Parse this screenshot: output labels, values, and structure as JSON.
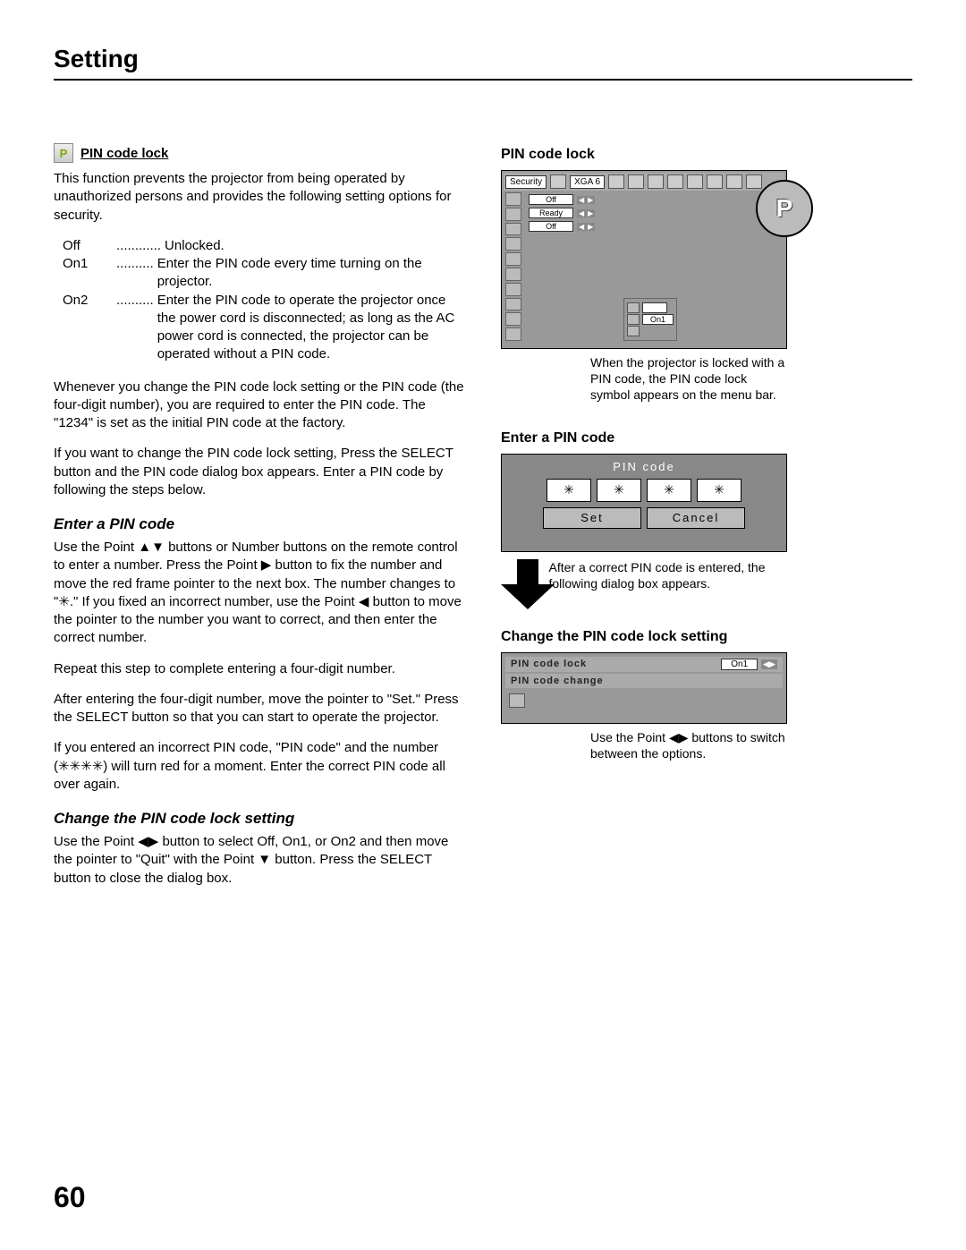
{
  "page": {
    "title": "Setting",
    "number": "60"
  },
  "left": {
    "heading1": "PIN code lock",
    "intro": "This function prevents the projector from being operated by unauthorized persons and provides the following setting options for security.",
    "options": [
      {
        "key": "Off",
        "dots": "............",
        "val": "Unlocked."
      },
      {
        "key": "On1",
        "dots": "..........",
        "val": "Enter the PIN code every time turning on the projector."
      },
      {
        "key": "On2",
        "dots": "..........",
        "val": "Enter the PIN code to operate the projector once the power cord is disconnected; as long as the AC power cord is connected, the projector can be operated without a PIN code."
      }
    ],
    "para2": "Whenever you change the PIN code lock setting or the PIN code (the four-digit number), you are required to enter the PIN code. The \"1234\" is set as the initial PIN code at the factory.",
    "para3": "If you want to change the PIN code lock setting, Press the SELECT button and the PIN code dialog box appears. Enter a PIN code by following the steps below.",
    "heading2": "Enter a PIN code",
    "enter_p1": "Use the Point ▲▼ buttons or Number buttons on the remote control to enter a number. Press the Point ▶ button to fix the number and move the red frame pointer to the next box. The number changes to \"✳.\" If you fixed an incorrect number, use the Point ◀ button to move the pointer to the number you want to correct, and then enter the correct number.",
    "enter_p2": "Repeat this step to complete entering a four-digit number.",
    "enter_p3": "After entering the four-digit number, move the pointer to \"Set.\" Press the SELECT button so that you can start to operate the projector.",
    "enter_p4": "If you entered an incorrect PIN code, \"PIN code\" and the number (✳✳✳✳) will turn red for a moment. Enter the correct PIN code all over again.",
    "heading3": "Change the PIN code lock setting",
    "change_p1": "Use the Point ◀▶ button to select Off, On1, or On2 and then move the pointer to \"Quit\" with the Point ▼ button. Press the SELECT button to close the dialog box."
  },
  "right": {
    "fig1_heading": "PIN code lock",
    "fig1_caption": "When the projector is locked with a PIN code, the PIN code lock symbol appears on the menu bar.",
    "fig1_menu": {
      "security_label": "Security",
      "xga_label": "XGA 6",
      "rows": [
        {
          "label": "Off"
        },
        {
          "label": "Ready"
        },
        {
          "label": "Off"
        }
      ],
      "sub_value": "On1",
      "callout": "P"
    },
    "fig2_heading": "Enter a PIN code",
    "fig2": {
      "title": "PIN code",
      "digits": [
        "✳",
        "✳",
        "✳",
        "✳"
      ],
      "set": "Set",
      "cancel": "Cancel"
    },
    "arrow_caption": "After a correct PIN code is entered, the following dialog box appears.",
    "fig3_heading": "Change the PIN code lock setting",
    "fig3": {
      "row1_label": "PIN code lock",
      "row1_value": "On1",
      "row2_label": "PIN code change"
    },
    "fig3_caption": "Use the Point ◀▶ buttons to switch between the options."
  }
}
